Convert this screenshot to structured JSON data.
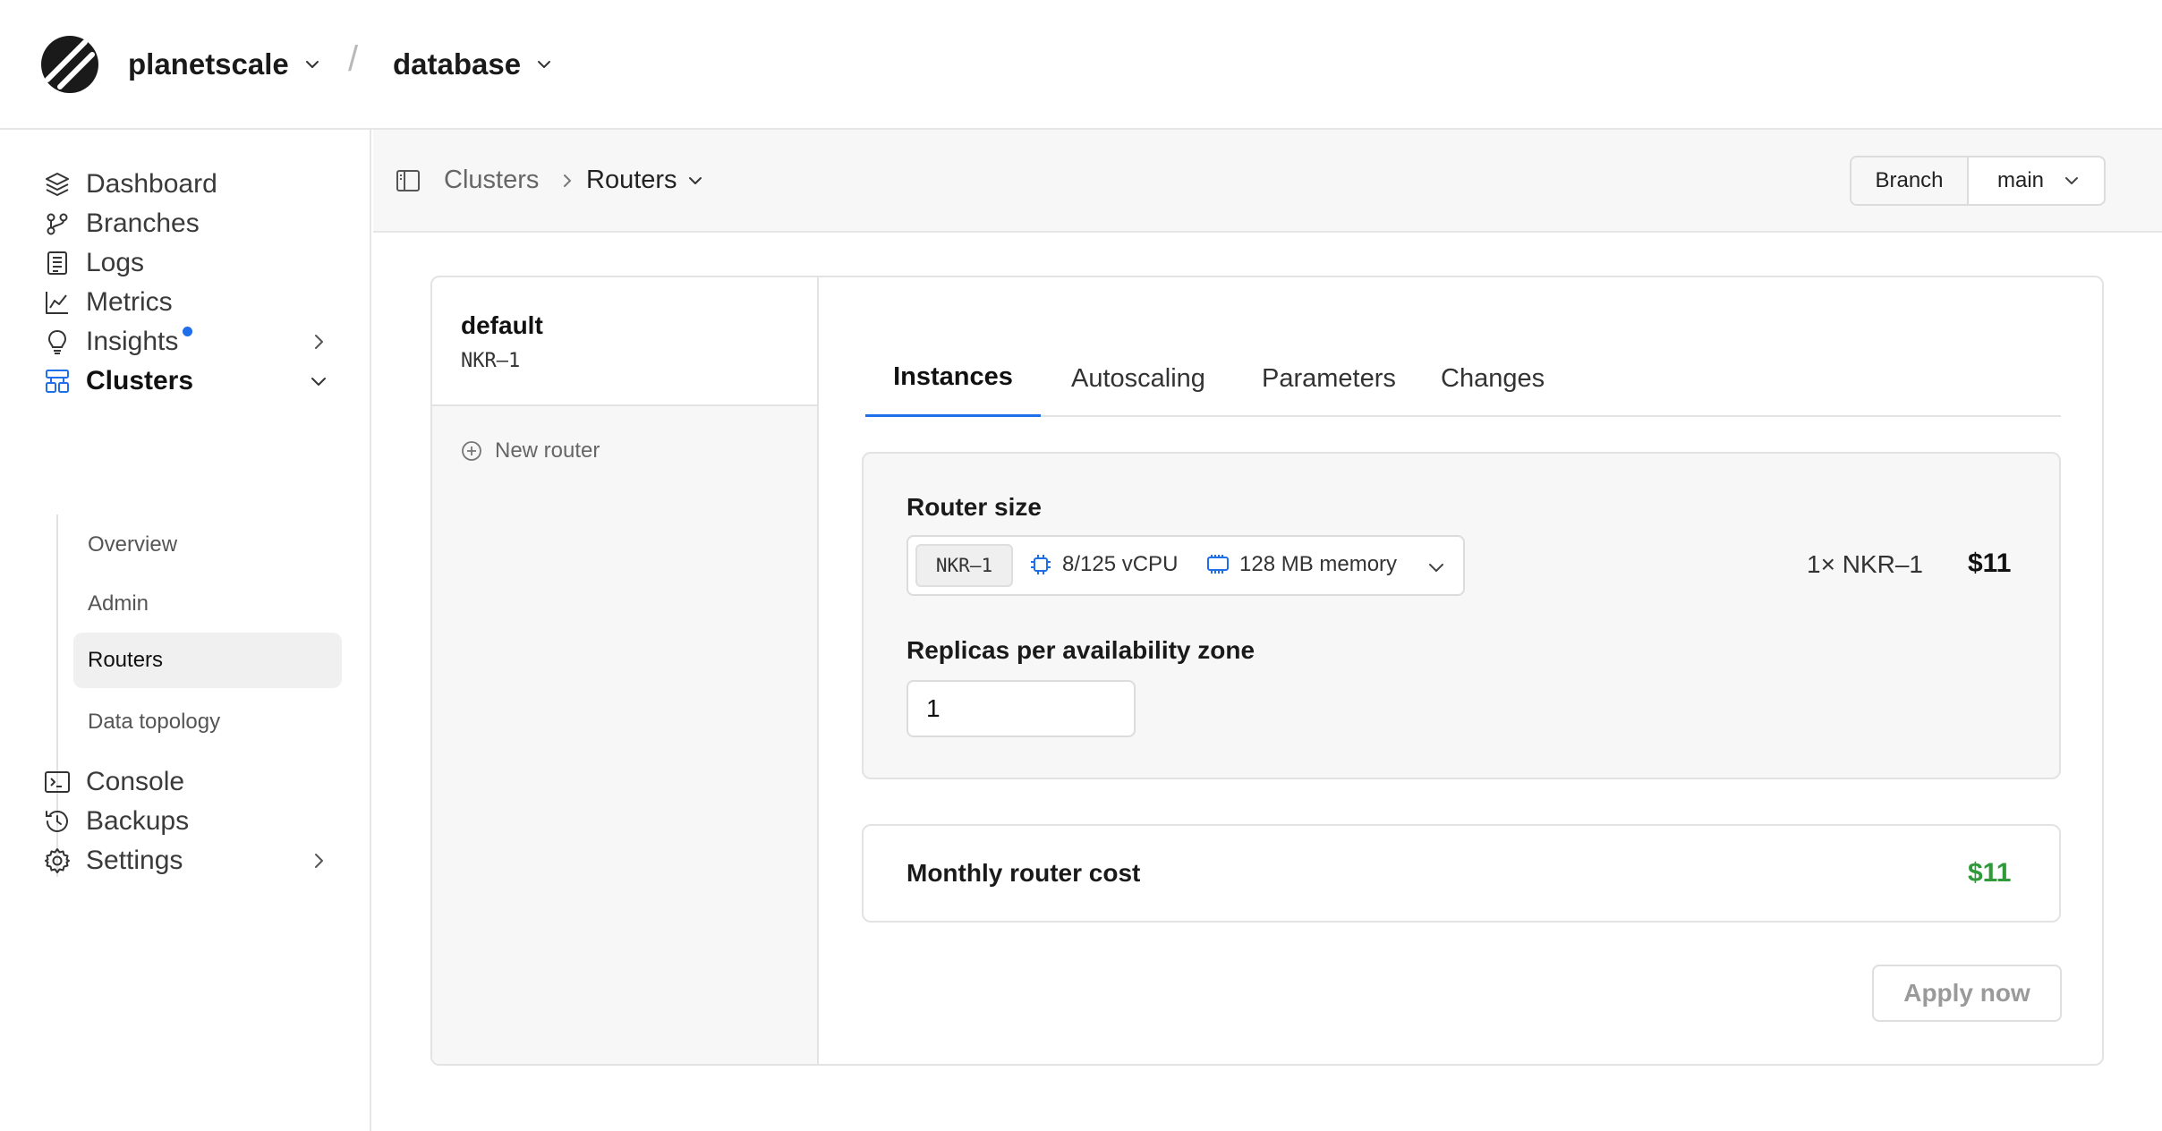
{
  "header": {
    "org_name": "planetscale",
    "separator": "/",
    "database_name": "database"
  },
  "sidebar": {
    "items": [
      {
        "label": "Dashboard",
        "icon": "layers-icon"
      },
      {
        "label": "Branches",
        "icon": "branches-icon"
      },
      {
        "label": "Logs",
        "icon": "logs-icon"
      },
      {
        "label": "Metrics",
        "icon": "metrics-chart-icon"
      },
      {
        "label": "Insights",
        "icon": "lightbulb-icon",
        "has_notification": true
      },
      {
        "label": "Clusters",
        "icon": "clusters-icon",
        "expanded": true
      },
      {
        "label": "Console",
        "icon": "terminal-icon"
      },
      {
        "label": "Backups",
        "icon": "history-clock-icon"
      },
      {
        "label": "Settings",
        "icon": "gear-icon"
      }
    ],
    "cluster_subitems": [
      "Overview",
      "Admin",
      "Routers",
      "Data topology"
    ],
    "selected_subitem": "Routers"
  },
  "breadcrumb": {
    "parent": "Clusters",
    "current": "Routers"
  },
  "branch": {
    "button_label": "Branch",
    "selected": "main"
  },
  "router_list": {
    "routers": [
      {
        "name": "default",
        "type": "NKR–1"
      }
    ],
    "new_router_label": "New router"
  },
  "tabs": {
    "items": [
      "Instances",
      "Autoscaling",
      "Parameters",
      "Changes"
    ],
    "active": "Instances"
  },
  "router_size": {
    "label": "Router size",
    "selected_type": "NKR–1",
    "vcpu": "8/125 vCPU",
    "memory": "128 MB memory",
    "quantity_label": "1× NKR–1",
    "price": "$11"
  },
  "replicas": {
    "label": "Replicas per availability zone",
    "value": "1"
  },
  "monthly_cost": {
    "label": "Monthly router cost",
    "value": "$11"
  },
  "actions": {
    "apply_label": "Apply now"
  },
  "colors": {
    "accent": "#1f6feb",
    "cost_green": "#2f9a3a",
    "panel_bg": "#f7f7f7"
  }
}
